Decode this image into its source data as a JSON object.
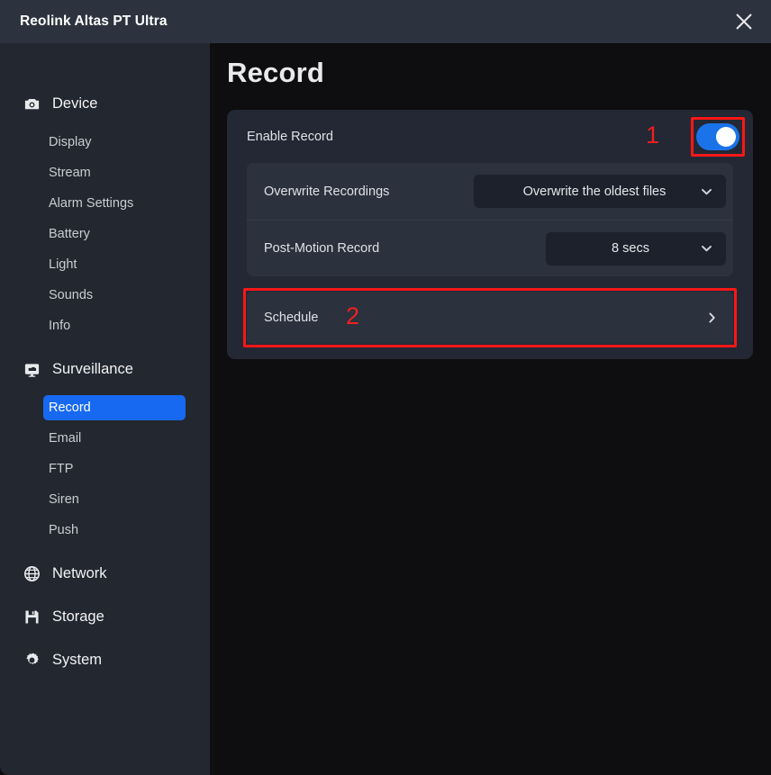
{
  "titlebar": {
    "title": "Reolink Altas PT Ultra",
    "close_icon": "close-icon"
  },
  "sidebar": {
    "sections": [
      {
        "label": "Device",
        "icon": "camera-icon",
        "items": [
          {
            "label": "Display",
            "active": false
          },
          {
            "label": "Stream",
            "active": false
          },
          {
            "label": "Alarm Settings",
            "active": false
          },
          {
            "label": "Battery",
            "active": false
          },
          {
            "label": "Light",
            "active": false
          },
          {
            "label": "Sounds",
            "active": false
          },
          {
            "label": "Info",
            "active": false
          }
        ]
      },
      {
        "label": "Surveillance",
        "icon": "monitor-icon",
        "items": [
          {
            "label": "Record",
            "active": true
          },
          {
            "label": "Email",
            "active": false
          },
          {
            "label": "FTP",
            "active": false
          },
          {
            "label": "Siren",
            "active": false
          },
          {
            "label": "Push",
            "active": false
          }
        ]
      },
      {
        "label": "Network",
        "icon": "globe-icon",
        "items": []
      },
      {
        "label": "Storage",
        "icon": "floppy-disk-icon",
        "items": []
      },
      {
        "label": "System",
        "icon": "gear-icon",
        "items": []
      }
    ]
  },
  "main": {
    "page_title": "Record",
    "enable_record": {
      "label": "Enable Record",
      "toggle_on": true,
      "annotation_marker": "1"
    },
    "settings": [
      {
        "label": "Overwrite Recordings",
        "value": "Overwrite the oldest files",
        "chevron_icon": "chevron-down-icon"
      },
      {
        "label": "Post-Motion Record",
        "value": "8 secs",
        "chevron_icon": "chevron-down-icon"
      }
    ],
    "schedule": {
      "label": "Schedule",
      "annotation_marker": "2",
      "chevron_icon": "chevron-right-icon"
    }
  },
  "colors": {
    "accent_blue": "#1669f0",
    "toggle_blue": "#1a73e8",
    "annotation_red": "#fb1717",
    "titlebar_bg": "#2d333e",
    "sidebar_bg": "#23272f",
    "content_bg": "#0e0e10",
    "card_bg": "#232834",
    "group_bg": "#2b313d",
    "select_bg": "#1d212b"
  }
}
